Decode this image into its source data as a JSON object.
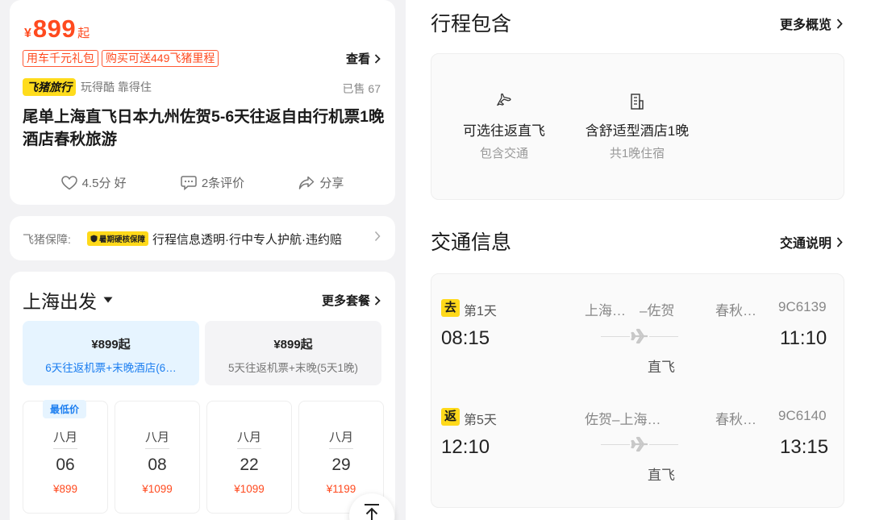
{
  "product": {
    "price_symbol": "¥",
    "price": "899",
    "price_suffix": "起",
    "tags": [
      "用车千元礼包",
      "购买可送449飞猪里程"
    ],
    "view_label": "查看",
    "brand_name": "飞猪旅行",
    "brand_slogan": "玩得酷 靠得住",
    "sold": "已售 67",
    "title": "尾单上海直飞日本九州佐贺5-6天往返自由行机票1晚酒店春秋旅游",
    "rating": "4.5分 好",
    "reviews": "2条评价",
    "share": "分享"
  },
  "guarantee": {
    "label": "飞猪保障:",
    "badge": "暑期硬核保障",
    "text": "行程信息透明·行中专人护航·违约赔"
  },
  "packages": {
    "departure": "上海出发",
    "more_label": "更多套餐",
    "options": [
      {
        "price": "¥899起",
        "desc": "6天往返机票+末晚酒店(6…"
      },
      {
        "price": "¥899起",
        "desc": "5天往返机票+末晚(5天1晚)"
      }
    ],
    "lowest_badge": "最低价",
    "dates": [
      {
        "month": "八月",
        "day": "06",
        "price": "¥899"
      },
      {
        "month": "八月",
        "day": "08",
        "price": "¥1099"
      },
      {
        "month": "八月",
        "day": "22",
        "price": "¥1099"
      },
      {
        "month": "八月",
        "day": "29",
        "price": "¥1199"
      }
    ]
  },
  "itinerary": {
    "title": "行程包含",
    "more_label": "更多概览",
    "items": [
      {
        "icon": "plane-icon",
        "main": "可选往返直飞",
        "sub": "包含交通"
      },
      {
        "icon": "hotel-icon",
        "main": "含舒适型酒店1晚",
        "sub": "共1晚住宿"
      }
    ]
  },
  "transport": {
    "title": "交通信息",
    "more_label": "交通说明",
    "segments": [
      {
        "badge": "去",
        "day": "第1天",
        "route": "上海…　–佐贺",
        "airline": "春秋…",
        "flight": "9C6139",
        "dep": "08:15",
        "arr": "11:10",
        "type": "直飞"
      },
      {
        "badge": "返",
        "day": "第5天",
        "route": "佐贺–上海…",
        "airline": "春秋…",
        "flight": "9C6140",
        "dep": "12:10",
        "arr": "13:15",
        "type": "直飞"
      }
    ]
  },
  "colors": {
    "accent": "#ff4a1f",
    "brand_yellow": "#ffdc1c",
    "link_blue": "#1c7ef0"
  }
}
